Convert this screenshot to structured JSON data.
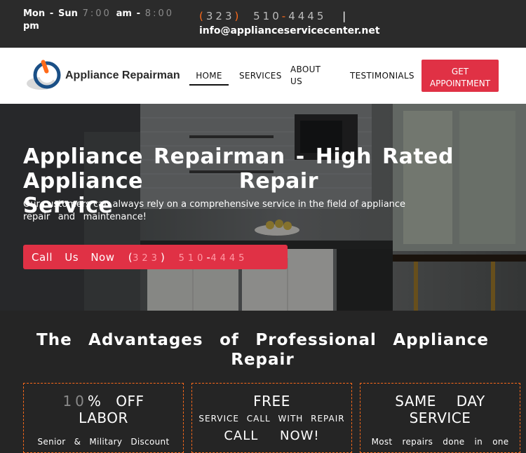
{
  "topbar": {
    "hours_days": "Mon - Sun",
    "hours_open": "7:00",
    "hours_am": "am -",
    "hours_close": "8:00",
    "hours_pm": "pm",
    "phone_area": "(323)",
    "phone_num": "510",
    "phone_dash": "-",
    "phone_rest": "4445",
    "separator": "|",
    "email": "info@applianceservicecenter.net"
  },
  "header": {
    "brand": "Appliance Repairman",
    "nav": {
      "home": "HOME",
      "services": "SERVICES",
      "about": "ABOUT US",
      "testimonials": "TESTIMONIALS"
    },
    "cta": "GET APPOINTMENT"
  },
  "hero": {
    "title_line1": "Appliance Repairman - High Rated",
    "title_line2": "Appliance Repair Service",
    "subtitle_line1": "Our customers can always rely on a comprehensive service in the field of appliance",
    "subtitle_line2": "repair and maintenance!",
    "call_label": "Call Us Now",
    "call_phone": "(323) 510-4445"
  },
  "advantages": {
    "title_line1": "The Advantages of Professional Appliance",
    "title_line2": "Repair",
    "cards": [
      {
        "num": "10",
        "heading_rest": "% OFF",
        "heading_line2": "LABOR",
        "text": "Senior & Military Discount"
      },
      {
        "heading": "FREE",
        "sub": "SERVICE CALL WITH REPAIR",
        "sub2": "CALL NOW!"
      },
      {
        "heading": "SAME DAY",
        "heading_line2": "SERVICE",
        "text": "Most repairs done in one"
      }
    ]
  },
  "colors": {
    "accent_orange": "#ff6a1a",
    "brand_red": "#e03145",
    "dark": "#2b2b2b"
  }
}
